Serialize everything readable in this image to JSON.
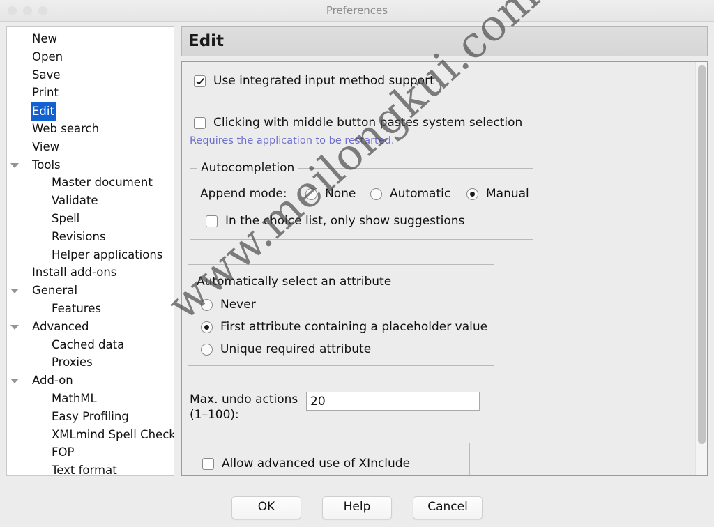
{
  "window": {
    "title": "Preferences",
    "traffic_lights": [
      "close-button",
      "minimize-button",
      "zoom-button"
    ]
  },
  "sidebar": {
    "items": [
      {
        "label": "New",
        "level": 0,
        "twisty": false,
        "selected": false
      },
      {
        "label": "Open",
        "level": 0,
        "twisty": false,
        "selected": false
      },
      {
        "label": "Save",
        "level": 0,
        "twisty": false,
        "selected": false
      },
      {
        "label": "Print",
        "level": 0,
        "twisty": false,
        "selected": false
      },
      {
        "label": "Edit",
        "level": 0,
        "twisty": false,
        "selected": true
      },
      {
        "label": "Web search",
        "level": 0,
        "twisty": false,
        "selected": false
      },
      {
        "label": "View",
        "level": 0,
        "twisty": false,
        "selected": false
      },
      {
        "label": "Tools",
        "level": 0,
        "twisty": true,
        "selected": false
      },
      {
        "label": "Master document",
        "level": 1,
        "twisty": false,
        "selected": false
      },
      {
        "label": "Validate",
        "level": 1,
        "twisty": false,
        "selected": false
      },
      {
        "label": "Spell",
        "level": 1,
        "twisty": false,
        "selected": false
      },
      {
        "label": "Revisions",
        "level": 1,
        "twisty": false,
        "selected": false
      },
      {
        "label": "Helper applications",
        "level": 1,
        "twisty": false,
        "selected": false
      },
      {
        "label": "Install add-ons",
        "level": 0,
        "twisty": false,
        "selected": false
      },
      {
        "label": "General",
        "level": 0,
        "twisty": true,
        "selected": false
      },
      {
        "label": "Features",
        "level": 1,
        "twisty": false,
        "selected": false
      },
      {
        "label": "Advanced",
        "level": 0,
        "twisty": true,
        "selected": false
      },
      {
        "label": "Cached data",
        "level": 1,
        "twisty": false,
        "selected": false
      },
      {
        "label": "Proxies",
        "level": 1,
        "twisty": false,
        "selected": false
      },
      {
        "label": "Add-on",
        "level": 0,
        "twisty": true,
        "selected": false
      },
      {
        "label": "MathML",
        "level": 1,
        "twisty": false,
        "selected": false
      },
      {
        "label": "Easy Profiling",
        "level": 1,
        "twisty": false,
        "selected": false
      },
      {
        "label": "XMLmind Spell Checker",
        "level": 1,
        "twisty": false,
        "selected": false
      },
      {
        "label": "FOP",
        "level": 1,
        "twisty": false,
        "selected": false
      },
      {
        "label": "Text format",
        "level": 1,
        "twisty": false,
        "selected": false
      }
    ]
  },
  "panel": {
    "title": "Edit",
    "input_method": {
      "label": "Use integrated input method support",
      "checked": true
    },
    "middle_button": {
      "label": "Clicking with middle button pastes system selection",
      "checked": false,
      "hint": "Requires the application to be restarted."
    },
    "autocompletion": {
      "title": "Autocompletion",
      "append_mode_label": "Append mode:",
      "options": [
        {
          "label": "None",
          "selected": false
        },
        {
          "label": "Automatic",
          "selected": false
        },
        {
          "label": "Manual",
          "selected": true
        }
      ],
      "only_show_suggestions": {
        "label": "In the choice list, only show suggestions",
        "checked": false
      }
    },
    "auto_select_attribute": {
      "title": "Automatically select an attribute",
      "options": [
        {
          "label": "Never",
          "selected": false
        },
        {
          "label": "First attribute containing a placeholder value",
          "selected": true
        },
        {
          "label": "Unique required attribute",
          "selected": false
        }
      ]
    },
    "max_undo": {
      "label_line1": "Max. undo actions",
      "label_line2": "(1–100):",
      "value": "20"
    },
    "xinclude": {
      "label": "Allow advanced use of XInclude",
      "checked": false
    }
  },
  "scrollbar": {
    "orientation": "vertical"
  },
  "footer": {
    "ok": "OK",
    "help": "Help",
    "cancel": "Cancel"
  },
  "watermark": {
    "text": "www.meilongkui.com"
  },
  "colors": {
    "selection": "#1261d2",
    "hint": "#6f6fcf",
    "window_bg": "#ececec",
    "panel_header": "#dedede"
  }
}
